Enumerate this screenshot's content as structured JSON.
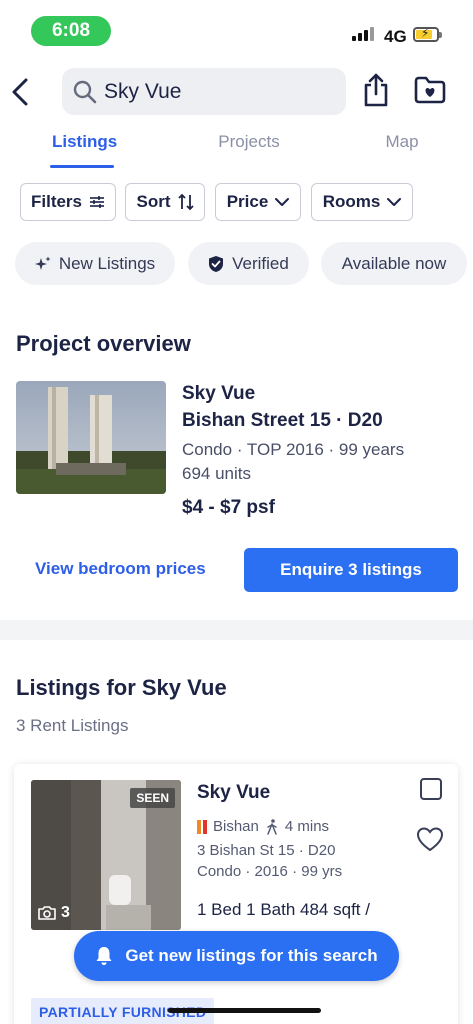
{
  "status_bar": {
    "time": "6:08",
    "network": "4G"
  },
  "search": {
    "value": "Sky Vue",
    "placeholder": ""
  },
  "tabs": [
    {
      "label": "Listings",
      "active": true
    },
    {
      "label": "Projects",
      "active": false
    },
    {
      "label": "Map",
      "active": false
    }
  ],
  "filters": [
    {
      "label": "Filters",
      "icon": "sliders-icon"
    },
    {
      "label": "Sort",
      "icon": "sort-arrows-icon"
    },
    {
      "label": "Price",
      "icon": "chevron-down-icon"
    },
    {
      "label": "Rooms",
      "icon": "chevron-down-icon"
    }
  ],
  "quick_filters": [
    {
      "label": "New Listings",
      "icon": "sparkle-icon"
    },
    {
      "label": "Verified",
      "icon": "shield-check-icon"
    },
    {
      "label": "Available now"
    }
  ],
  "project_overview": {
    "heading": "Project overview",
    "name": "Sky Vue",
    "address": "Bishan Street 15 · D20",
    "meta": "Condo · TOP 2016 · 99 years",
    "units": "694 units",
    "psf": "$4 - $7 psf",
    "view_prices_label": "View bedroom prices",
    "enquire_label": "Enquire 3 listings"
  },
  "listings": {
    "heading": "Listings for Sky Vue",
    "count_text": "3 Rent Listings",
    "items": [
      {
        "title": "Sky Vue",
        "seen_label": "SEEN",
        "photo_count": "3",
        "mrt": "Bishan",
        "walk": "4 mins",
        "address": "3 Bishan St 15 · D20",
        "meta": "Condo · 2016 · 99 yrs",
        "specs": "1 Bed   1 Bath   484 sqft /",
        "furnishing": "PARTIALLY FURNISHED"
      }
    ]
  },
  "alert_cta": {
    "label": "Get new listings for this search"
  },
  "colors": {
    "accent": "#2d5ee8",
    "button": "#2b6ff2",
    "time_pill": "#34c759",
    "mrt_orange": "#f08a24",
    "mrt_red": "#e2342b"
  }
}
